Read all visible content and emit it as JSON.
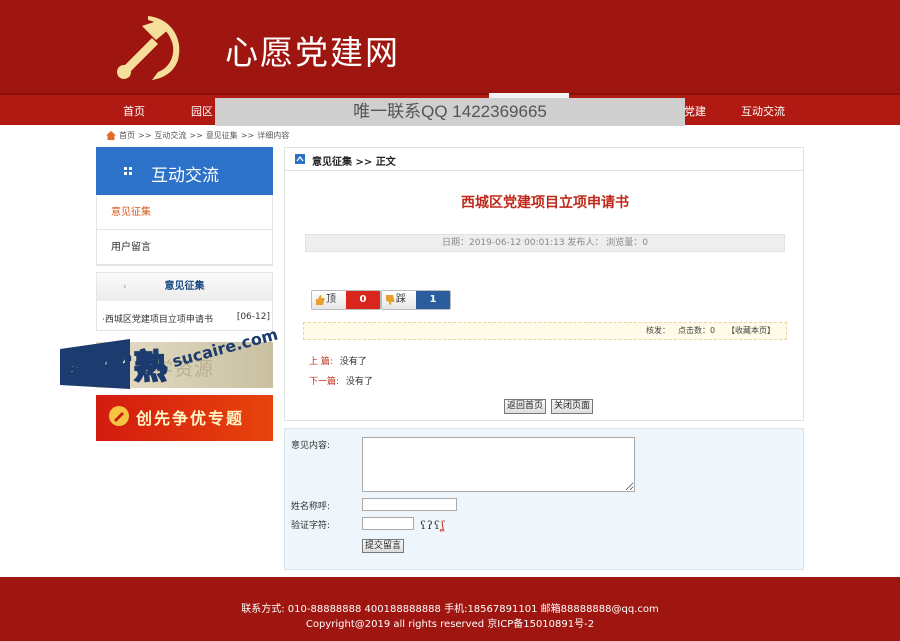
{
  "header": {
    "site_title": "心愿党建网",
    "nav": [
      "首页",
      "园区",
      "党建",
      "互动交流"
    ],
    "watermark_banner": "唯一联系QQ 1422369665"
  },
  "breadcrumb": {
    "home": "首页",
    "sep": ">>",
    "level2": "互动交流",
    "level3": "意见征集",
    "level4": "详细内容"
  },
  "sidebar": {
    "title": "互动交流",
    "menu": [
      {
        "label": "意见征集",
        "active": true
      },
      {
        "label": "用户留言",
        "active": false
      }
    ],
    "box_title": "意见征集",
    "box_arrow": "›",
    "box_item": {
      "title": "·西城区党建项目立项申请书",
      "date": "[06-12]"
    },
    "promo1_text": "学资源",
    "watermark_cn": "素材熟",
    "watermark_en": "sucaire.com",
    "promo2_text": "创先争优专题"
  },
  "article": {
    "section_path": "意见征集 >> 正文",
    "title": "西城区党建项目立项申请书",
    "meta": "日期：2019-06-12 00:01:13   发布人：    浏览量：0",
    "vote_up": {
      "label": "顶",
      "count": "0"
    },
    "vote_down": {
      "label": "踩",
      "count": "1"
    },
    "info_k1": "核发：",
    "info_k2": "点击数：0",
    "info_k3": "【收藏本页】",
    "prev_label": "上  篇:",
    "prev_value": "没有了",
    "next_label": "下一篇:",
    "next_value": "没有了",
    "back_home": "返回首页",
    "close_page": "关闭页面"
  },
  "form": {
    "content_label": "意见内容:",
    "name_label": "姓名称呼:",
    "captcha_label": "验证字符:",
    "captcha_text": "ʕʔʕ",
    "captcha_red": "ʆ",
    "submit": "提交留言"
  },
  "footer": {
    "line1": "联系方式: 010-88888888 400188888888 手机:18567891101 邮箱88888888@qq.com",
    "line2": "Copyright@2019 all rights reserved 京ICP备15010891号-2"
  },
  "colors": {
    "brand_red": "#9f1610",
    "accent_blue": "#2d72c9",
    "title_red": "#c0291a"
  }
}
